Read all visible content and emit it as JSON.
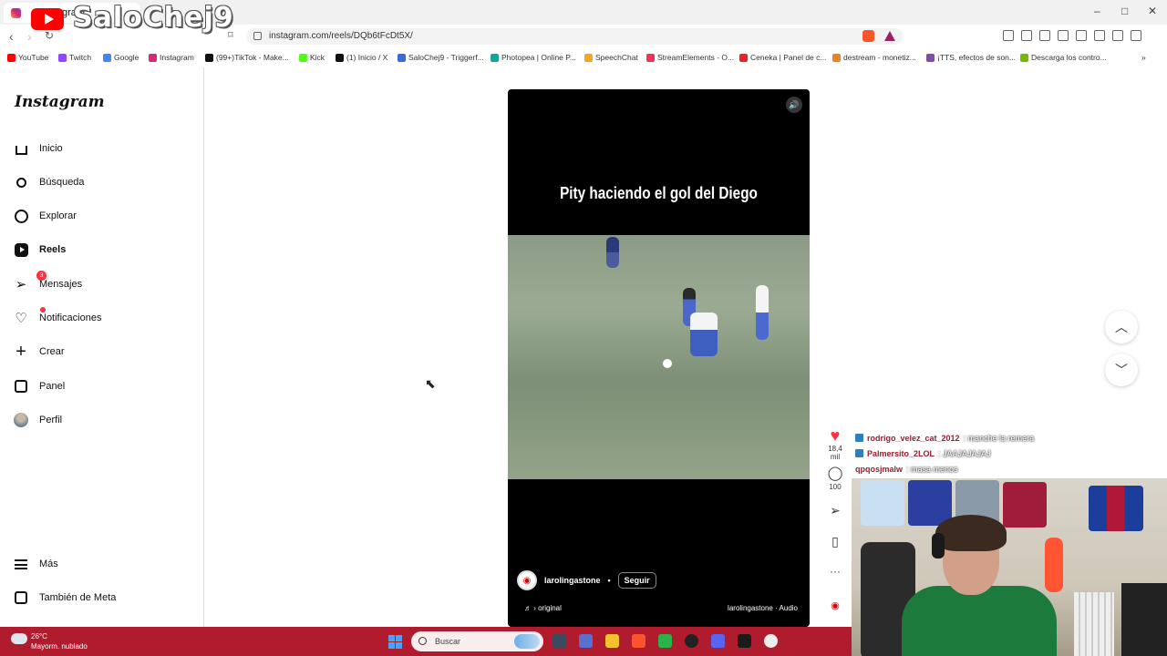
{
  "browser": {
    "tab_title": "gram",
    "url": "instagram.com/reels/DQb6tFcDt5X/",
    "bookmarks": [
      "YouTube",
      "Twitch",
      "Google",
      "Instagram",
      "(99+)TikTok - Make...",
      "Kick",
      "(1) Inicio / X",
      "SaloChej9 - Triggerf...",
      "Photopea | Online P...",
      "SpeechChat",
      "StreamElements - O...",
      "Ceneka | Panel de c...",
      "destream - monetiz...",
      "¡TTS, efectos de son...",
      "Descarga los contro..."
    ]
  },
  "overlay": {
    "streamer": "SaloChej9"
  },
  "instagram": {
    "logo": "Instagram",
    "nav": [
      "Inicio",
      "Búsqueda",
      "Explorar",
      "Reels",
      "Mensajes",
      "Notificaciones",
      "Crear",
      "Panel",
      "Perfil"
    ],
    "messages_badge": "3",
    "more": "Más",
    "meta": "También de Meta"
  },
  "reel": {
    "caption": "Pity haciendo el gol del Diego",
    "author": "larolingastone",
    "separator": "•",
    "follow": "Seguir",
    "audio_left": "♬ › original",
    "audio_right": "larolingastone · Audio",
    "likes": "18,4 mil",
    "comments": "100"
  },
  "chat": [
    {
      "user": "rodrigo_velez_cat_2012",
      "msg": ": manche la remera"
    },
    {
      "user": "Palmersito_2LOL",
      "msg": ": JAAJAJAJAJ"
    },
    {
      "user": "qpqosjmalw",
      "msg": ": masa menos"
    }
  ],
  "taskbar": {
    "temp": "26°C",
    "weather": "Mayorm. nublado",
    "search": "Buscar"
  },
  "colors": {
    "taskbar": "#b01c2e",
    "like": "#ff3040",
    "chat_user": "#9a1c2f"
  }
}
